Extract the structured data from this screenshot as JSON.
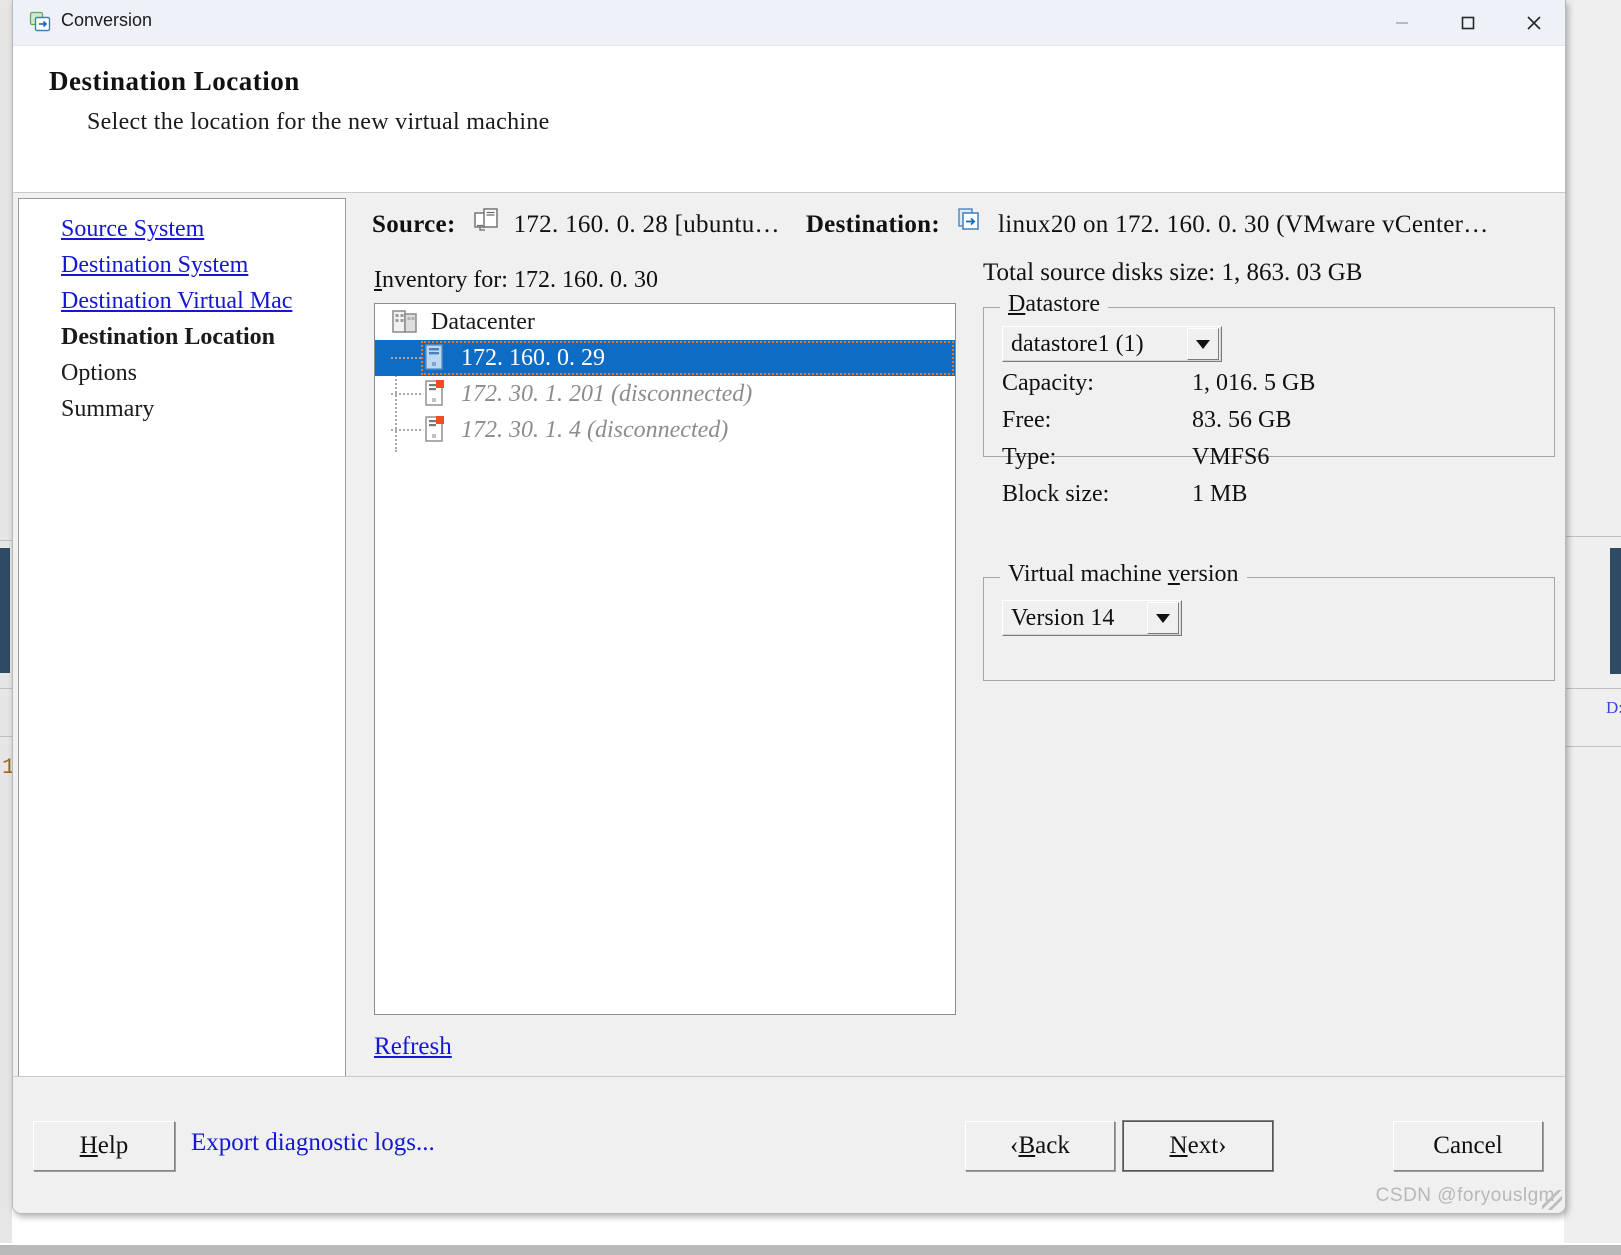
{
  "window": {
    "title": "Conversion",
    "icon": "conversion-icon",
    "controls": {
      "minimize": "—",
      "maximize": "☐",
      "close": "✕"
    }
  },
  "header": {
    "title": "Destination Location",
    "subtitle": "Select the location for the new virtual machine"
  },
  "sidebar": {
    "items": [
      {
        "label": "Source System",
        "state": "link"
      },
      {
        "label": "Destination System",
        "state": "link"
      },
      {
        "label": "Destination Virtual Mac",
        "state": "link"
      },
      {
        "label": "Destination Location",
        "state": "current"
      },
      {
        "label": "Options",
        "state": "normal"
      },
      {
        "label": "Summary",
        "state": "normal"
      }
    ],
    "scrollbar": {
      "left_arrow": "◂",
      "right_arrow": "▸"
    }
  },
  "summary_bar": {
    "source_label": "Source:",
    "source_icon": "source-machine-icon",
    "source_value": "172. 160. 0. 28  [ubuntu…",
    "destination_label": "Destination:",
    "destination_icon": "destination-vm-icon",
    "destination_value": "linux20 on 172. 160. 0. 30  (VMware vCenter…"
  },
  "inventory": {
    "label_accel": "I",
    "label_rest": "nventory for:  172. 160. 0. 30",
    "tree": [
      {
        "label": "Datacenter",
        "icon": "datacenter-icon",
        "level": 0,
        "state": "normal"
      },
      {
        "label": "172. 160. 0. 29",
        "icon": "host-icon",
        "level": 1,
        "state": "selected"
      },
      {
        "label": "172. 30. 1. 201  (disconnected)",
        "icon": "host-disconnected-icon",
        "level": 1,
        "state": "disconnected"
      },
      {
        "label": "172. 30. 1. 4  (disconnected)",
        "icon": "host-disconnected-icon",
        "level": 1,
        "state": "disconnected"
      }
    ],
    "refresh_accel": "R",
    "refresh_rest": "efresh"
  },
  "details": {
    "total_source_disks_size": "Total source disks size:  1, 863. 03 GB",
    "datastore": {
      "legend_accel": "D",
      "legend_rest": "atastore",
      "selected": "datastore1 (1)",
      "options": [
        "datastore1 (1)"
      ],
      "rows": [
        {
          "key": "Capacity:",
          "value": "1, 016. 5 GB"
        },
        {
          "key": "Free:",
          "value": "83. 56 GB"
        },
        {
          "key": "Type:",
          "value": "VMFS6"
        },
        {
          "key": "Block size:",
          "value": "1 MB"
        }
      ]
    },
    "vm_version": {
      "legend_pre": "Virtual machine ",
      "legend_accel": "v",
      "legend_rest": "ersion",
      "selected": "Version 14",
      "options": [
        "Version 14"
      ]
    }
  },
  "footer": {
    "help_accel": "H",
    "help_rest": "elp",
    "export_logs": "Export diagnostic logs...",
    "back_pre": "‹ ",
    "back_accel": "B",
    "back_rest": "ack",
    "next_accel": "N",
    "next_rest": "ext",
    "next_post": " ›",
    "cancel": "Cancel"
  },
  "watermark": "CSDN @foryouslgm",
  "background": {
    "top_text": "——  ———  — ———  ————  ——",
    "right_text": "D:"
  },
  "colors": {
    "accent_blue": "#0f6cc4",
    "link_blue": "#1417d4",
    "focus_orange": "#e8762c",
    "disconnected_gray": "#8c8c8c",
    "dialog_bg": "#f0f0f0",
    "titlebar_bg": "#eef2f8"
  }
}
